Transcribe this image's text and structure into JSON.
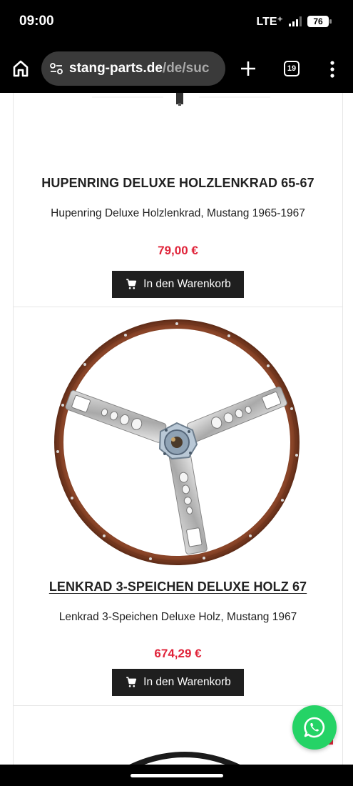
{
  "status_bar": {
    "time": "09:00",
    "network": "LTE⁺",
    "battery": "76"
  },
  "browser": {
    "url_domain": "stang-parts.de",
    "url_path": "/de/suc",
    "tab_count": "19",
    "icons": [
      "home-icon",
      "site-settings-icon",
      "new-tab-plus-icon",
      "tab-switcher-icon",
      "overflow-menu-icon"
    ]
  },
  "products": [
    {
      "title": "HUPENRING DELUXE HOLZLENKRAD 65-67",
      "description": "Hupenring Deluxe Holzlenkrad, Mustang 1965-1967",
      "price": "79,00 €",
      "button_label": "In den Warenkorb"
    },
    {
      "title": "LENKRAD 3-SPEICHEN DELUXE HOLZ 67",
      "description": "Lenkrad 3-Speichen Deluxe Holz, Mustang 1967",
      "price": "674,29 €",
      "button_label": "In den Warenkorb"
    }
  ],
  "colors": {
    "price": "#e0243a",
    "button_bg": "#1f1f1f",
    "whatsapp": "#25d366"
  }
}
